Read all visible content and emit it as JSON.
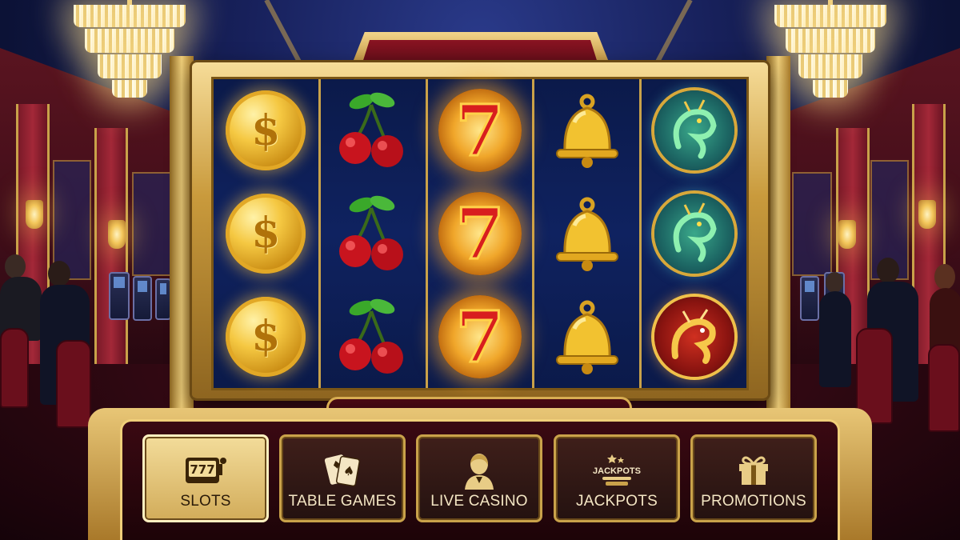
{
  "menu": {
    "active_item": "slots",
    "items": [
      {
        "id": "slots",
        "label": "SLOTS",
        "icon": "slot-machine-icon"
      },
      {
        "id": "table-games",
        "label": "TABLE GAMES",
        "icon": "playing-cards-icon"
      },
      {
        "id": "live-casino",
        "label": "LIVE CASINO",
        "icon": "dealer-icon"
      },
      {
        "id": "jackpots",
        "label": "JACKPOTS",
        "icon": "jackpot-badge-icon"
      },
      {
        "id": "promotions",
        "label": "PROMOTIONS",
        "icon": "gift-icon"
      }
    ]
  },
  "icons": {
    "slots_icon_text": "777",
    "jackpots_icon_text": "JACKPOTS"
  },
  "reels": {
    "symbols": [
      [
        "gold-dollar-coin",
        "gold-dollar-coin",
        "gold-dollar-coin"
      ],
      [
        "cherries",
        "cherries",
        "cherries"
      ],
      [
        "lucky-seven",
        "lucky-seven",
        "lucky-seven"
      ],
      [
        "golden-bell",
        "golden-bell",
        "golden-bell"
      ],
      [
        "green-dragon",
        "green-dragon",
        "golden-dragon"
      ]
    ],
    "coin_glyph": "$",
    "seven_glyph": "7"
  },
  "colors": {
    "gold": "#c9a24a",
    "reel_background": "#0a1740",
    "active_tab": "#f3dc9a",
    "burgundy": "#3a0912"
  }
}
